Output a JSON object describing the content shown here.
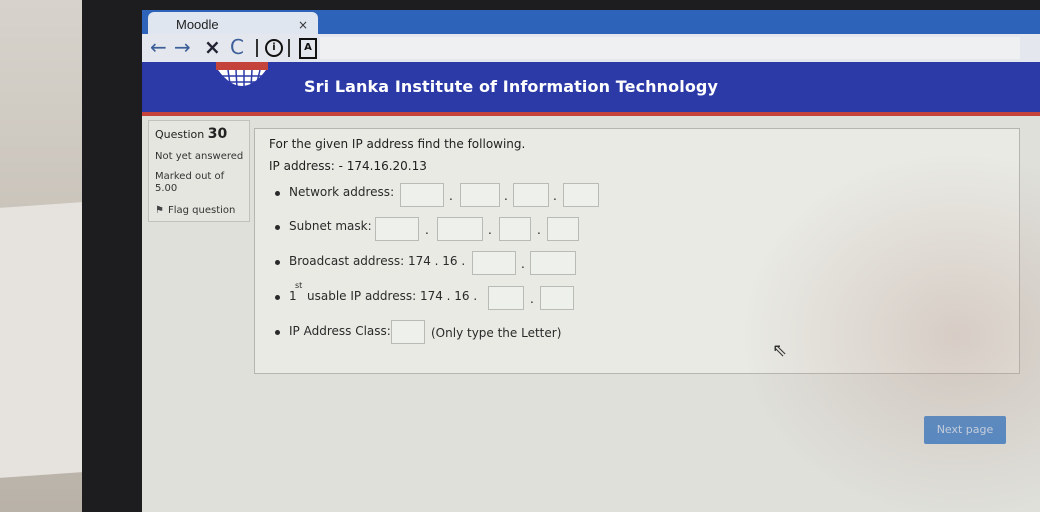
{
  "browser": {
    "tab_title": "Moodle",
    "tab_close": "×",
    "nav": {
      "back": "←",
      "forward": "→",
      "stop": "×",
      "reload": "C"
    },
    "icons": [
      "info-icon",
      "page-icon"
    ]
  },
  "site": {
    "title": "Sri Lanka Institute of Information Technology"
  },
  "question_info": {
    "label": "Question",
    "number": "30",
    "status": "Not yet answered",
    "marked_out_of": "Marked out of",
    "marks": "5.00",
    "flag_label": "Flag question"
  },
  "question": {
    "prompt": "For the given IP address find the following.",
    "ip_line": "IP address: - 174.16.20.13",
    "items": {
      "network": "Network address:",
      "subnet": "Subnet mask:",
      "broadcast": "Broadcast address: 174 . 16 .",
      "usable_num": "1",
      "usable_sup": "st",
      "usable": "usable IP address: 174 . 16 .",
      "class": "IP Address Class:",
      "class_hint": "(Only type the Letter)"
    },
    "dot": "."
  },
  "navigation": {
    "next_label": "Next page"
  },
  "colors": {
    "header_blue": "#2c3aa8",
    "header_accent": "#c4443b",
    "tab_strip": "#2d63b8",
    "next_button": "#4a86c8"
  }
}
